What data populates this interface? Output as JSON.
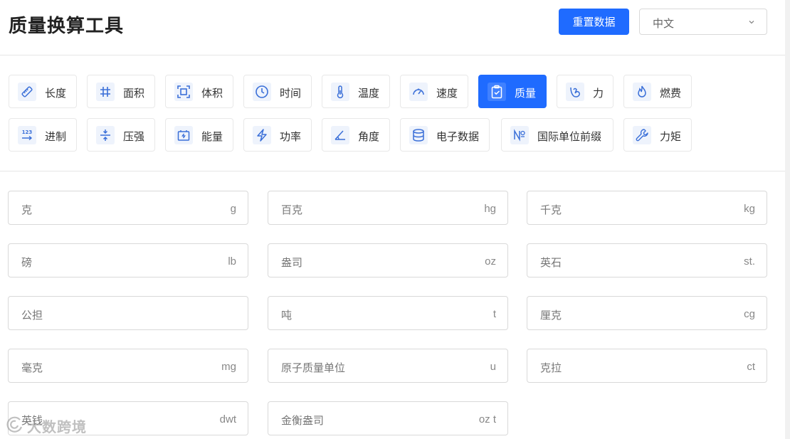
{
  "header": {
    "title": "质量换算工具",
    "reset_label": "重置数据",
    "language": "中文"
  },
  "categories": [
    {
      "label": "长度",
      "icon": "ruler-icon"
    },
    {
      "label": "面积",
      "icon": "hash-icon"
    },
    {
      "label": "体积",
      "icon": "box-frame-icon"
    },
    {
      "label": "时间",
      "icon": "clock-icon"
    },
    {
      "label": "温度",
      "icon": "thermometer-icon"
    },
    {
      "label": "速度",
      "icon": "speedometer-icon"
    },
    {
      "label": "质量",
      "icon": "clipboard-check-icon",
      "active": true
    },
    {
      "label": "力",
      "icon": "strength-icon"
    },
    {
      "label": "燃费",
      "icon": "flame-icon"
    },
    {
      "label": "进制",
      "icon": "number-base-icon"
    },
    {
      "label": "压强",
      "icon": "compress-icon"
    },
    {
      "label": "能量",
      "icon": "battery-icon"
    },
    {
      "label": "功率",
      "icon": "lightning-icon"
    },
    {
      "label": "角度",
      "icon": "angle-icon"
    },
    {
      "label": "电子数据",
      "icon": "database-icon"
    },
    {
      "label": "国际单位前缀",
      "icon": "numero-icon"
    },
    {
      "label": "力矩",
      "icon": "wrench-icon"
    }
  ],
  "units": [
    {
      "name": "克",
      "unit": "g"
    },
    {
      "name": "百克",
      "unit": "hg"
    },
    {
      "name": "千克",
      "unit": "kg"
    },
    {
      "name": "磅",
      "unit": "lb"
    },
    {
      "name": "盎司",
      "unit": "oz"
    },
    {
      "name": "英石",
      "unit": "st."
    },
    {
      "name": "公担",
      "unit": ""
    },
    {
      "name": "吨",
      "unit": "t"
    },
    {
      "name": "厘克",
      "unit": "cg"
    },
    {
      "name": "毫克",
      "unit": "mg"
    },
    {
      "name": "原子质量单位",
      "unit": "u"
    },
    {
      "name": "克拉",
      "unit": "ct"
    },
    {
      "name": "英钱",
      "unit": "dwt"
    },
    {
      "name": "金衡盎司",
      "unit": "oz t"
    }
  ],
  "watermark": "大数跨境",
  "colors": {
    "accent": "#1f6bff",
    "icon_blue": "#3a6fd8"
  }
}
